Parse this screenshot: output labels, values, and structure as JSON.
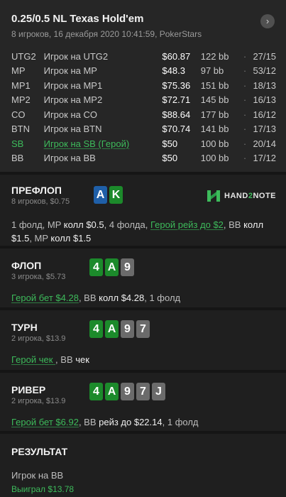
{
  "header": {
    "title": "0.25/0.5 NL Texas Hold'em",
    "subtitle": "8 игроков, 16 декабря 2020 10:41:59, PokerStars",
    "close_icon": "›"
  },
  "players": [
    {
      "pos": "UTG2",
      "name": "Игрок на UTG2",
      "stack": "$60.87",
      "bb": "122 bb",
      "sep": "·",
      "stats": "27/15",
      "hero": false
    },
    {
      "pos": "MP",
      "name": "Игрок на MP",
      "stack": "$48.3",
      "bb": "97 bb",
      "sep": "·",
      "stats": "53/12",
      "hero": false
    },
    {
      "pos": "MP1",
      "name": "Игрок на MP1",
      "stack": "$75.36",
      "bb": "151 bb",
      "sep": "·",
      "stats": "18/13",
      "hero": false
    },
    {
      "pos": "MP2",
      "name": "Игрок на MP2",
      "stack": "$72.71",
      "bb": "145 bb",
      "sep": "·",
      "stats": "16/13",
      "hero": false
    },
    {
      "pos": "CO",
      "name": "Игрок на CO",
      "stack": "$88.64",
      "bb": "177 bb",
      "sep": "·",
      "stats": "16/12",
      "hero": false
    },
    {
      "pos": "BTN",
      "name": "Игрок на BTN",
      "stack": "$70.74",
      "bb": "141 bb",
      "sep": "·",
      "stats": "17/13",
      "hero": false
    },
    {
      "pos": "SB",
      "name": "Игрок на SB (Герой)",
      "stack": "$50",
      "bb": "100 bb",
      "sep": "·",
      "stats": "20/14",
      "hero": true
    },
    {
      "pos": "BB",
      "name": "Игрок на BB",
      "stack": "$50",
      "bb": "100 bb",
      "sep": "·",
      "stats": "17/12",
      "hero": false
    }
  ],
  "preflop": {
    "title": "ПРЕФЛОП",
    "sub": "8 игроков, $0.75",
    "cards": [
      "A",
      "K"
    ],
    "logo_text_a": "HAND",
    "logo_text_b": "2",
    "logo_text_c": "NOTE",
    "a1": "1 фолд, ",
    "a2": "MP",
    "a3": " колл $0.5",
    "a4": ", 4 фолда, ",
    "a5": "Герой рейз до $2",
    "a6": ", ",
    "a7": "BB",
    "a8": " колл $1.5",
    "a9": ", ",
    "a10": "MP",
    "a11": " колл $1.5"
  },
  "flop": {
    "title": "ФЛОП",
    "sub": "3 игрока, $5.73",
    "cards": [
      "4",
      "A",
      "9"
    ],
    "a1": "Герой бет $4.28",
    "a2": ", ",
    "a3": "BB",
    "a4": " колл $4.28",
    "a5": ", 1 фолд"
  },
  "turn": {
    "title": "ТУРН",
    "sub": "2 игрока, $13.9",
    "cards": [
      "4",
      "A",
      "9",
      "7"
    ],
    "a1": "Герой чек ",
    "a2": ", ",
    "a3": "BB",
    "a4": " чек"
  },
  "river": {
    "title": "РИВЕР",
    "sub": "2 игрока, $13.9",
    "cards": [
      "4",
      "A",
      "9",
      "7",
      "J"
    ],
    "a1": "Герой бет $6.92",
    "a2": ", ",
    "a3": "BB",
    "a4": " рейз до $22.14",
    "a5": ", 1 фолд"
  },
  "result": {
    "title": "РЕЗУЛЬТАТ",
    "player": "Игрок на BB",
    "won": "Выиграл $13.78"
  },
  "colors": {
    "hero_green": "#3dbb5b",
    "card_green": "#1c8a2b",
    "card_blue": "#1f5fa8",
    "card_gray": "#6b6b6b"
  }
}
